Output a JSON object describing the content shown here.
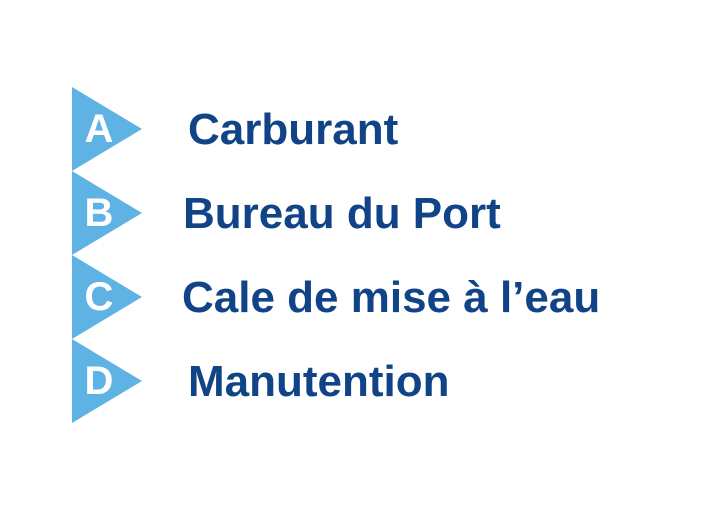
{
  "colors": {
    "marker_fill": "#5eb3e4",
    "marker_letter": "#ffffff",
    "label_text": "#114486",
    "background": "#ffffff"
  },
  "items": [
    {
      "letter": "A",
      "label": "Carburant",
      "icon": "triangle-marker-icon"
    },
    {
      "letter": "B",
      "label": "Bureau du Port",
      "icon": "triangle-marker-icon"
    },
    {
      "letter": "C",
      "label": "Cale de mise à l’eau",
      "icon": "triangle-marker-icon"
    },
    {
      "letter": "D",
      "label": "Manutention",
      "icon": "triangle-marker-icon"
    }
  ]
}
